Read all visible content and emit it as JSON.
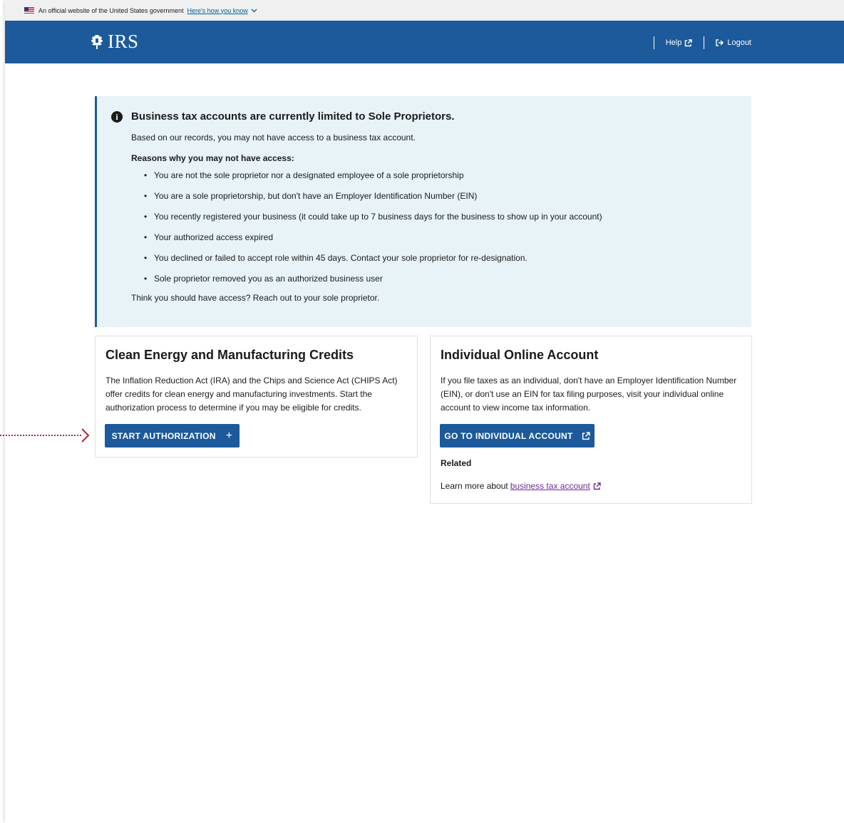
{
  "gov_banner": {
    "text": "An official website of the United States government",
    "link": "Here's how you know"
  },
  "header": {
    "logo_text": "IRS",
    "help_label": "Help",
    "logout_label": "Logout"
  },
  "alert": {
    "title": "Business tax accounts are currently limited to Sole Proprietors.",
    "body": "Based on our records, you may not have access to a business tax account.",
    "reasons_heading": "Reasons why you may not have access:",
    "reasons": [
      "You are not the sole proprietor nor a designated employee of a sole proprietorship",
      "You are a sole proprietorship, but don't have an Employer Identification Number (EIN)",
      "You recently registered your business (it could take up to 7 business days for the business to show up in your account)",
      "Your authorized access expired",
      "You declined or failed to accept role within 45 days. Contact your sole proprietor for re-designation.",
      "Sole proprietor removed you as an authorized business user"
    ],
    "footer": "Think you should have access? Reach out to your sole proprietor."
  },
  "clean_energy_card": {
    "title": "Clean Energy and Manufacturing Credits",
    "description": "The Inflation Reduction Act (IRA) and the Chips and Science Act (CHIPS Act) offer credits for clean energy and manufacturing investments. Start the authorization process to determine if you may be eligible for credits.",
    "button_label": "START AUTHORIZATION",
    "button_icon": "+"
  },
  "individual_card": {
    "title": "Individual Online Account",
    "description": "If you file taxes as an individual, don't have an Employer Identification Number (EIN), or don't use an EIN for tax filing purposes, visit your individual online account to view income tax information.",
    "button_label": "GO TO INDIVIDUAL ACCOUNT",
    "related_heading": "Related",
    "learn_more_text": "Learn more about",
    "learn_more_link": "business tax account"
  },
  "colors": {
    "header_blue": "#1c5a9b",
    "alert_bg": "#e7f3f6",
    "link_purple": "#6b2e8f",
    "annotation_red": "#b02639"
  },
  "icons": [
    "us-flag-icon",
    "chevron-down-icon",
    "irs-eagle-icon",
    "external-link-icon",
    "logout-icon",
    "info-icon",
    "plus-icon",
    "annotation-arrow"
  ]
}
